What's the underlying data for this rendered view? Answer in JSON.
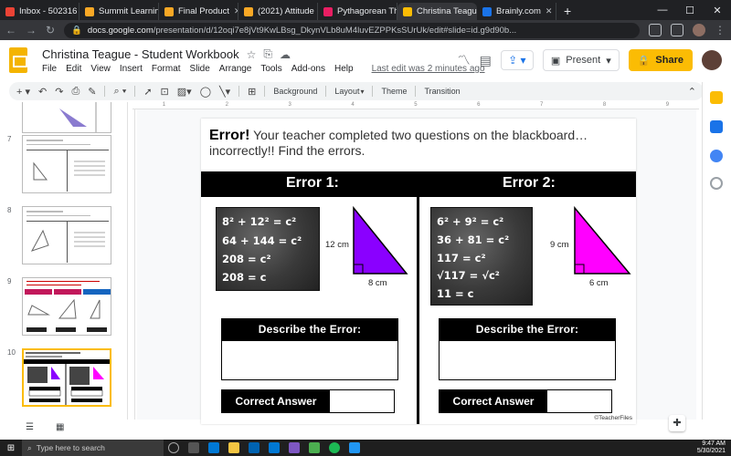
{
  "browser": {
    "tabs": [
      {
        "label": "Inbox - 502316",
        "color": "#ea4335"
      },
      {
        "label": "Summit Learning",
        "color": "#f9a825"
      },
      {
        "label": "Final Product",
        "color": "#f9a825"
      },
      {
        "label": "(2021) Attitude",
        "color": "#f9a825"
      },
      {
        "label": "Pythagorean Th",
        "color": "#e91e63"
      },
      {
        "label": "Christina Teague",
        "color": "#fbbc04"
      },
      {
        "label": "Brainly.com",
        "color": "#1a73e8"
      }
    ],
    "url_domain": "docs.google.com",
    "url_path": "/presentation/d/12oqi7e8jVt9KwLBsg_DkynVLb8uM4luvEZPPKsSUrUk/edit#slide=id.g9d90b..."
  },
  "header": {
    "title": "Christina Teague - Student Workbook",
    "menu": [
      "File",
      "Edit",
      "View",
      "Insert",
      "Format",
      "Slide",
      "Arrange",
      "Tools",
      "Add-ons",
      "Help"
    ],
    "last_edit": "Last edit was 2 minutes ago",
    "present_label": "Present",
    "share_label": "Share"
  },
  "toolbar": {
    "background": "Background",
    "layout": "Layout",
    "theme": "Theme",
    "transition": "Transition"
  },
  "filmstrip": {
    "numbers": [
      "7",
      "8",
      "9",
      "10"
    ]
  },
  "ruler": [
    "1",
    "2",
    "3",
    "4",
    "5",
    "6",
    "7",
    "8",
    "9"
  ],
  "slide": {
    "title_bold": "Error!",
    "title_rest": " Your teacher completed two questions on the blackboard… incorrectly!! Find the errors.",
    "error1": "Error 1:",
    "error2": "Error 2:",
    "board1": [
      "8² + 12² = c²",
      "64 + 144 = c²",
      "208 = c²",
      "208 = c"
    ],
    "board2": [
      "6² + 9² = c²",
      "36 + 81 = c²",
      "117 = c²",
      "√117 = √c²",
      "11 = c"
    ],
    "tri1_side": "12 cm",
    "tri1_base": "8 cm",
    "tri1_color": "#8a00ff",
    "tri2_side": "9 cm",
    "tri2_base": "6 cm",
    "tri2_color": "#ff00ff",
    "describe": "Describe the Error:",
    "correct": "Correct Answer",
    "credit": "©TeacherFiles"
  },
  "taskbar": {
    "search": "Type here to search",
    "time": "9:47 AM",
    "date": "5/30/2021"
  }
}
